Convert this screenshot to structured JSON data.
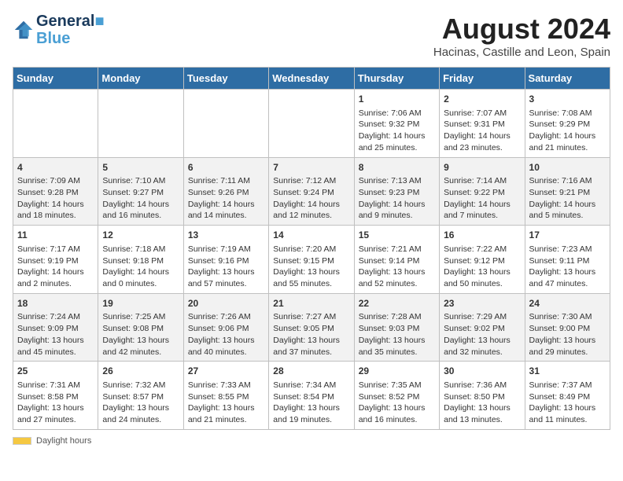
{
  "header": {
    "logo_line1": "General",
    "logo_line2": "Blue",
    "month_year": "August 2024",
    "location": "Hacinas, Castille and Leon, Spain"
  },
  "weekdays": [
    "Sunday",
    "Monday",
    "Tuesday",
    "Wednesday",
    "Thursday",
    "Friday",
    "Saturday"
  ],
  "weeks": [
    [
      {
        "day": "",
        "info": ""
      },
      {
        "day": "",
        "info": ""
      },
      {
        "day": "",
        "info": ""
      },
      {
        "day": "",
        "info": ""
      },
      {
        "day": "1",
        "info": "Sunrise: 7:06 AM\nSunset: 9:32 PM\nDaylight: 14 hours and 25 minutes."
      },
      {
        "day": "2",
        "info": "Sunrise: 7:07 AM\nSunset: 9:31 PM\nDaylight: 14 hours and 23 minutes."
      },
      {
        "day": "3",
        "info": "Sunrise: 7:08 AM\nSunset: 9:29 PM\nDaylight: 14 hours and 21 minutes."
      }
    ],
    [
      {
        "day": "4",
        "info": "Sunrise: 7:09 AM\nSunset: 9:28 PM\nDaylight: 14 hours and 18 minutes."
      },
      {
        "day": "5",
        "info": "Sunrise: 7:10 AM\nSunset: 9:27 PM\nDaylight: 14 hours and 16 minutes."
      },
      {
        "day": "6",
        "info": "Sunrise: 7:11 AM\nSunset: 9:26 PM\nDaylight: 14 hours and 14 minutes."
      },
      {
        "day": "7",
        "info": "Sunrise: 7:12 AM\nSunset: 9:24 PM\nDaylight: 14 hours and 12 minutes."
      },
      {
        "day": "8",
        "info": "Sunrise: 7:13 AM\nSunset: 9:23 PM\nDaylight: 14 hours and 9 minutes."
      },
      {
        "day": "9",
        "info": "Sunrise: 7:14 AM\nSunset: 9:22 PM\nDaylight: 14 hours and 7 minutes."
      },
      {
        "day": "10",
        "info": "Sunrise: 7:16 AM\nSunset: 9:21 PM\nDaylight: 14 hours and 5 minutes."
      }
    ],
    [
      {
        "day": "11",
        "info": "Sunrise: 7:17 AM\nSunset: 9:19 PM\nDaylight: 14 hours and 2 minutes."
      },
      {
        "day": "12",
        "info": "Sunrise: 7:18 AM\nSunset: 9:18 PM\nDaylight: 14 hours and 0 minutes."
      },
      {
        "day": "13",
        "info": "Sunrise: 7:19 AM\nSunset: 9:16 PM\nDaylight: 13 hours and 57 minutes."
      },
      {
        "day": "14",
        "info": "Sunrise: 7:20 AM\nSunset: 9:15 PM\nDaylight: 13 hours and 55 minutes."
      },
      {
        "day": "15",
        "info": "Sunrise: 7:21 AM\nSunset: 9:14 PM\nDaylight: 13 hours and 52 minutes."
      },
      {
        "day": "16",
        "info": "Sunrise: 7:22 AM\nSunset: 9:12 PM\nDaylight: 13 hours and 50 minutes."
      },
      {
        "day": "17",
        "info": "Sunrise: 7:23 AM\nSunset: 9:11 PM\nDaylight: 13 hours and 47 minutes."
      }
    ],
    [
      {
        "day": "18",
        "info": "Sunrise: 7:24 AM\nSunset: 9:09 PM\nDaylight: 13 hours and 45 minutes."
      },
      {
        "day": "19",
        "info": "Sunrise: 7:25 AM\nSunset: 9:08 PM\nDaylight: 13 hours and 42 minutes."
      },
      {
        "day": "20",
        "info": "Sunrise: 7:26 AM\nSunset: 9:06 PM\nDaylight: 13 hours and 40 minutes."
      },
      {
        "day": "21",
        "info": "Sunrise: 7:27 AM\nSunset: 9:05 PM\nDaylight: 13 hours and 37 minutes."
      },
      {
        "day": "22",
        "info": "Sunrise: 7:28 AM\nSunset: 9:03 PM\nDaylight: 13 hours and 35 minutes."
      },
      {
        "day": "23",
        "info": "Sunrise: 7:29 AM\nSunset: 9:02 PM\nDaylight: 13 hours and 32 minutes."
      },
      {
        "day": "24",
        "info": "Sunrise: 7:30 AM\nSunset: 9:00 PM\nDaylight: 13 hours and 29 minutes."
      }
    ],
    [
      {
        "day": "25",
        "info": "Sunrise: 7:31 AM\nSunset: 8:58 PM\nDaylight: 13 hours and 27 minutes."
      },
      {
        "day": "26",
        "info": "Sunrise: 7:32 AM\nSunset: 8:57 PM\nDaylight: 13 hours and 24 minutes."
      },
      {
        "day": "27",
        "info": "Sunrise: 7:33 AM\nSunset: 8:55 PM\nDaylight: 13 hours and 21 minutes."
      },
      {
        "day": "28",
        "info": "Sunrise: 7:34 AM\nSunset: 8:54 PM\nDaylight: 13 hours and 19 minutes."
      },
      {
        "day": "29",
        "info": "Sunrise: 7:35 AM\nSunset: 8:52 PM\nDaylight: 13 hours and 16 minutes."
      },
      {
        "day": "30",
        "info": "Sunrise: 7:36 AM\nSunset: 8:50 PM\nDaylight: 13 hours and 13 minutes."
      },
      {
        "day": "31",
        "info": "Sunrise: 7:37 AM\nSunset: 8:49 PM\nDaylight: 13 hours and 11 minutes."
      }
    ]
  ],
  "footer": {
    "daylight_label": "Daylight hours"
  }
}
